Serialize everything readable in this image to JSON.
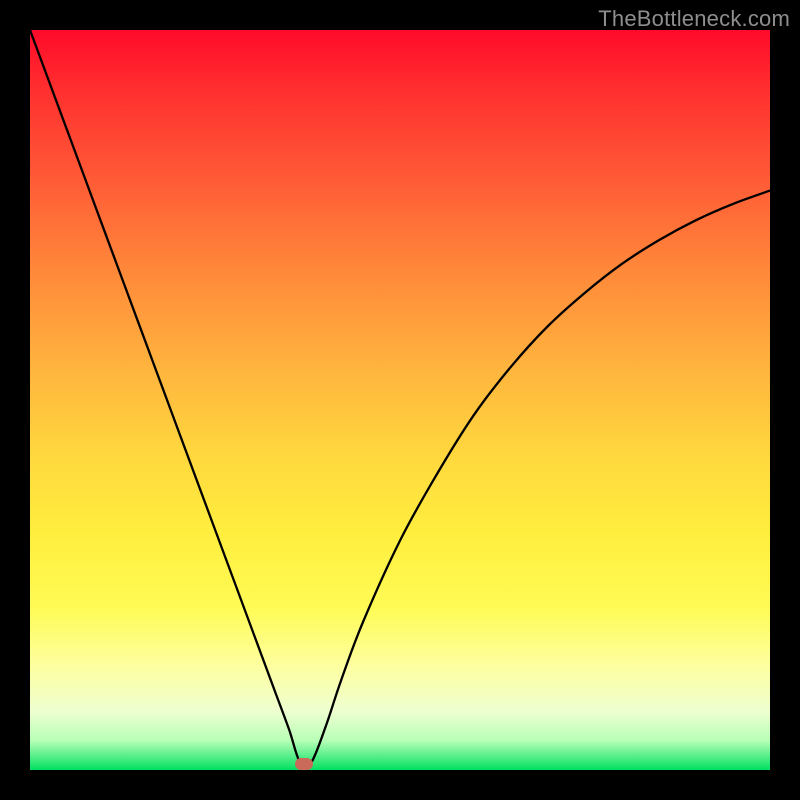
{
  "watermark": {
    "text": "TheBottleneck.com"
  },
  "chart_data": {
    "type": "line",
    "title": "",
    "xlabel": "",
    "ylabel": "",
    "xlim": [
      0,
      100
    ],
    "ylim": [
      0,
      100
    ],
    "grid": false,
    "legend": false,
    "series": [
      {
        "name": "bottleneck-curve",
        "x": [
          0,
          5,
          10,
          15,
          20,
          25,
          30,
          33,
          35,
          36.5,
          38,
          40,
          42,
          45,
          50,
          55,
          60,
          65,
          70,
          75,
          80,
          85,
          90,
          95,
          100
        ],
        "y": [
          100,
          86.5,
          73,
          59.5,
          46,
          32.5,
          19,
          10.9,
          5.5,
          1,
          1,
          6,
          12,
          20,
          31,
          40,
          48,
          54.5,
          60,
          64.5,
          68.4,
          71.6,
          74.3,
          76.5,
          78.3
        ]
      }
    ],
    "marker": {
      "x": 37,
      "y": 0.8,
      "color": "#c96a5a"
    },
    "background_gradient": {
      "top": "#ff0a2a",
      "mid": "#ffd93e",
      "bottom": "#00e060"
    }
  }
}
